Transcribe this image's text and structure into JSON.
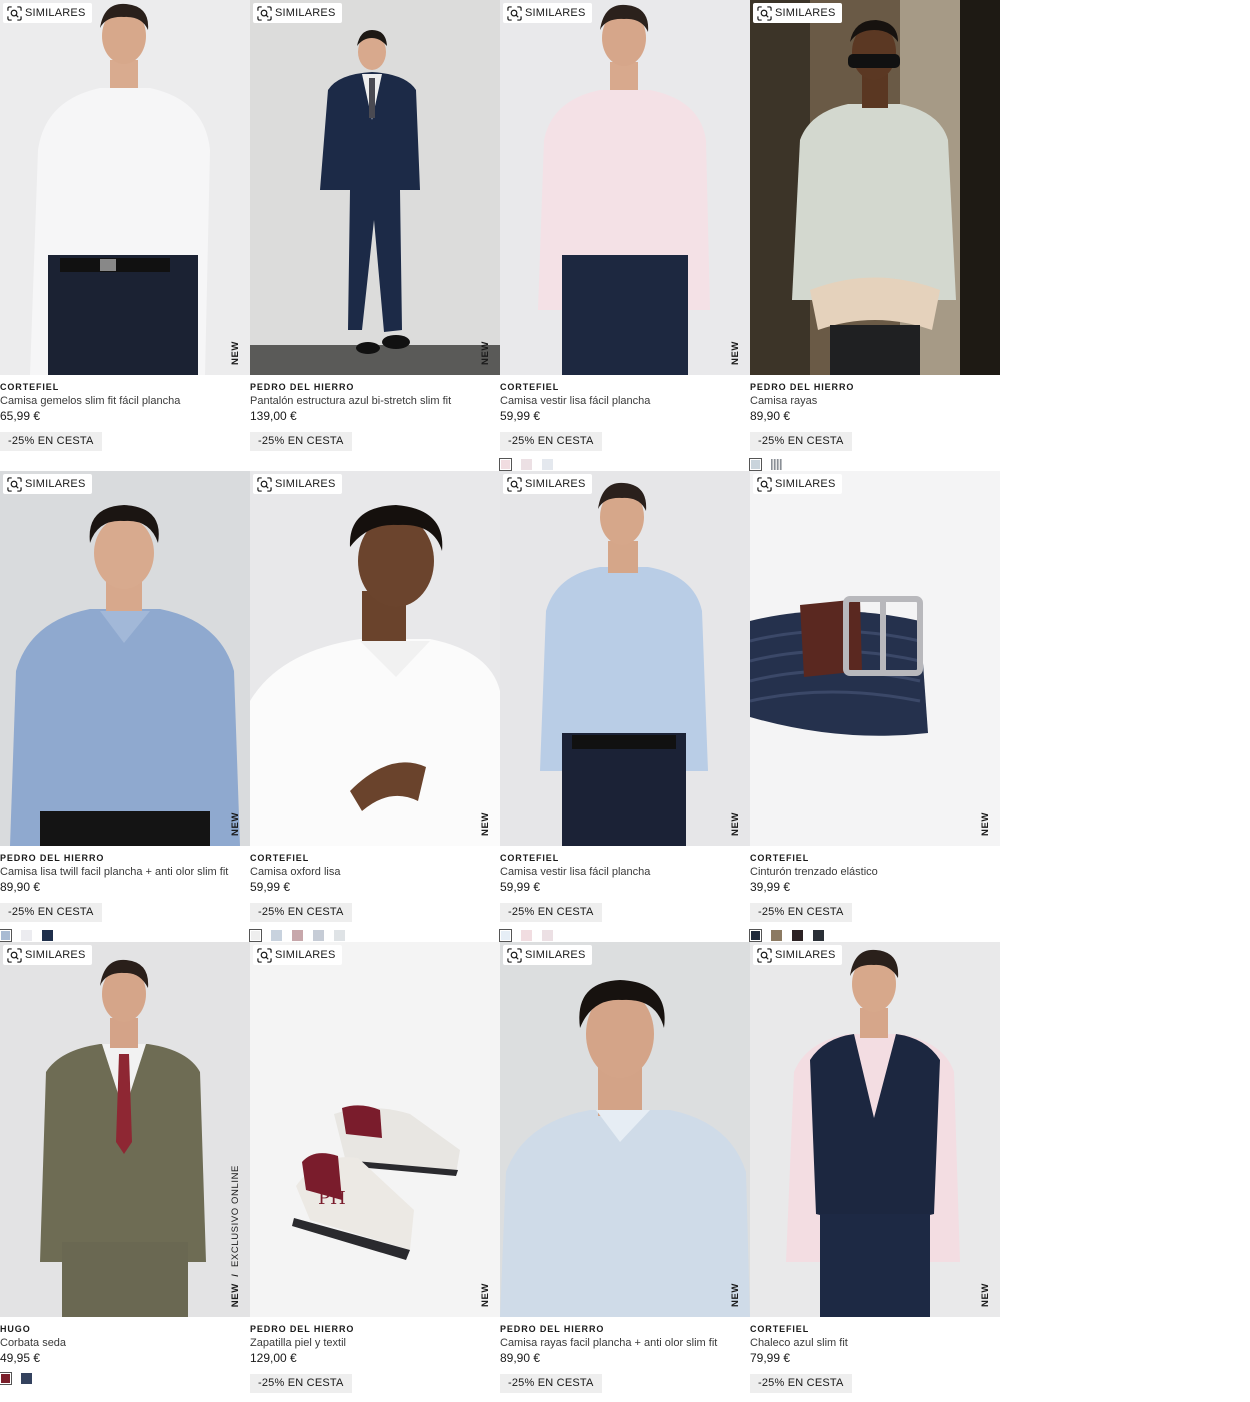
{
  "similar_label": "SIMILARES",
  "new_label": "NEW",
  "exclusive_label": "EXCLUSIVO ONLINE",
  "products": [
    {
      "brand": "CORTEFIEL",
      "name": "Camisa gemelos slim fit fácil plancha",
      "price": "65,99 €",
      "promo": "-25% EN CESTA",
      "swatches": []
    },
    {
      "brand": "PEDRO DEL HIERRO",
      "name": "Pantalón estructura azul bi-stretch slim fit",
      "price": "139,00 €",
      "promo": "-25% EN CESTA",
      "swatches": []
    },
    {
      "brand": "CORTEFIEL",
      "name": "Camisa vestir lisa fácil plancha",
      "price": "59,99 €",
      "promo": "-25% EN CESTA",
      "swatches": [
        "#f1dde1",
        "#ece0e4",
        "#e4e8ee"
      ]
    },
    {
      "brand": "PEDRO DEL HIERRO",
      "name": "Camisa rayas",
      "price": "89,90 €",
      "promo": "-25% EN CESTA",
      "swatches": [
        "#c9d4dc",
        "#9aa0a6"
      ]
    },
    {
      "brand": "PEDRO DEL HIERRO",
      "name": "Camisa lisa twill facil plancha + anti olor slim fit",
      "price": "89,90 €",
      "promo": "-25% EN CESTA",
      "swatches": [
        "#a9bbd3",
        "#ececf0",
        "#1f2f4b"
      ]
    },
    {
      "brand": "CORTEFIEL",
      "name": "Camisa oxford lisa",
      "price": "59,99 €",
      "promo": "-25% EN CESTA",
      "swatches": [
        "#eeeeee",
        "#c8d2de",
        "#c7a7ab",
        "#c6ccd6",
        "#dfe3e6"
      ]
    },
    {
      "brand": "CORTEFIEL",
      "name": "Camisa vestir lisa fácil plancha",
      "price": "59,99 €",
      "promo": "-25% EN CESTA",
      "swatches": [
        "#e6eef6",
        "#f1dde1",
        "#ece0e4"
      ]
    },
    {
      "brand": "CORTEFIEL",
      "name": "Cinturón trenzado elástico",
      "price": "39,99 €",
      "promo": "-25% EN CESTA",
      "swatches": [
        "#1f2a3c",
        "#8c7a62",
        "#2c2224",
        "#2a2f36"
      ]
    },
    {
      "brand": "HUGO",
      "name": "Corbata seda",
      "price": "49,95 €",
      "promo": "",
      "swatches": [
        "#7a1e2a",
        "#34425e"
      ]
    },
    {
      "brand": "PEDRO DEL HIERRO",
      "name": "Zapatilla piel y textil",
      "price": "129,00 €",
      "promo": "-25% EN CESTA",
      "swatches": []
    },
    {
      "brand": "PEDRO DEL HIERRO",
      "name": "Camisa rayas facil plancha + anti olor slim fit",
      "price": "89,90 €",
      "promo": "-25% EN CESTA",
      "swatches": []
    },
    {
      "brand": "CORTEFIEL",
      "name": "Chaleco azul slim fit",
      "price": "79,99 €",
      "promo": "-25% EN CESTA",
      "swatches": []
    }
  ]
}
